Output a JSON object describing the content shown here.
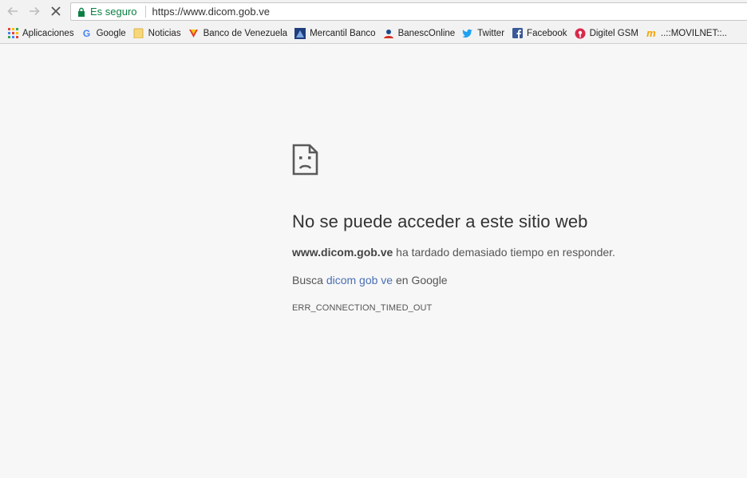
{
  "omnibox": {
    "security_label": "Es seguro",
    "url": "https://www.dicom.gob.ve"
  },
  "bookmarks": [
    {
      "label": "Aplicaciones",
      "icon": "apps-grid-icon"
    },
    {
      "label": "Google",
      "icon": "google-icon"
    },
    {
      "label": "Noticias",
      "icon": "folder-icon"
    },
    {
      "label": "Banco de Venezuela",
      "icon": "bdv-icon"
    },
    {
      "label": "Mercantil Banco",
      "icon": "mercantil-icon"
    },
    {
      "label": "BanescOnline",
      "icon": "banesco-icon"
    },
    {
      "label": "Twitter",
      "icon": "twitter-icon"
    },
    {
      "label": "Facebook",
      "icon": "facebook-icon"
    },
    {
      "label": "Digitel GSM",
      "icon": "digitel-icon"
    },
    {
      "label": "..::MOVILNET::..",
      "icon": "movilnet-icon"
    }
  ],
  "error": {
    "title": "No se puede acceder a este sitio web",
    "host": "www.dicom.gob.ve",
    "message": " ha tardado demasiado tiempo en responder.",
    "search_prefix": "Busca ",
    "search_link": "dicom gob ve",
    "search_suffix": " en Google",
    "code": "ERR_CONNECTION_TIMED_OUT"
  },
  "colors": {
    "secure": "#0b8043",
    "link": "#4a6fb5",
    "background": "#f7f7f7"
  }
}
